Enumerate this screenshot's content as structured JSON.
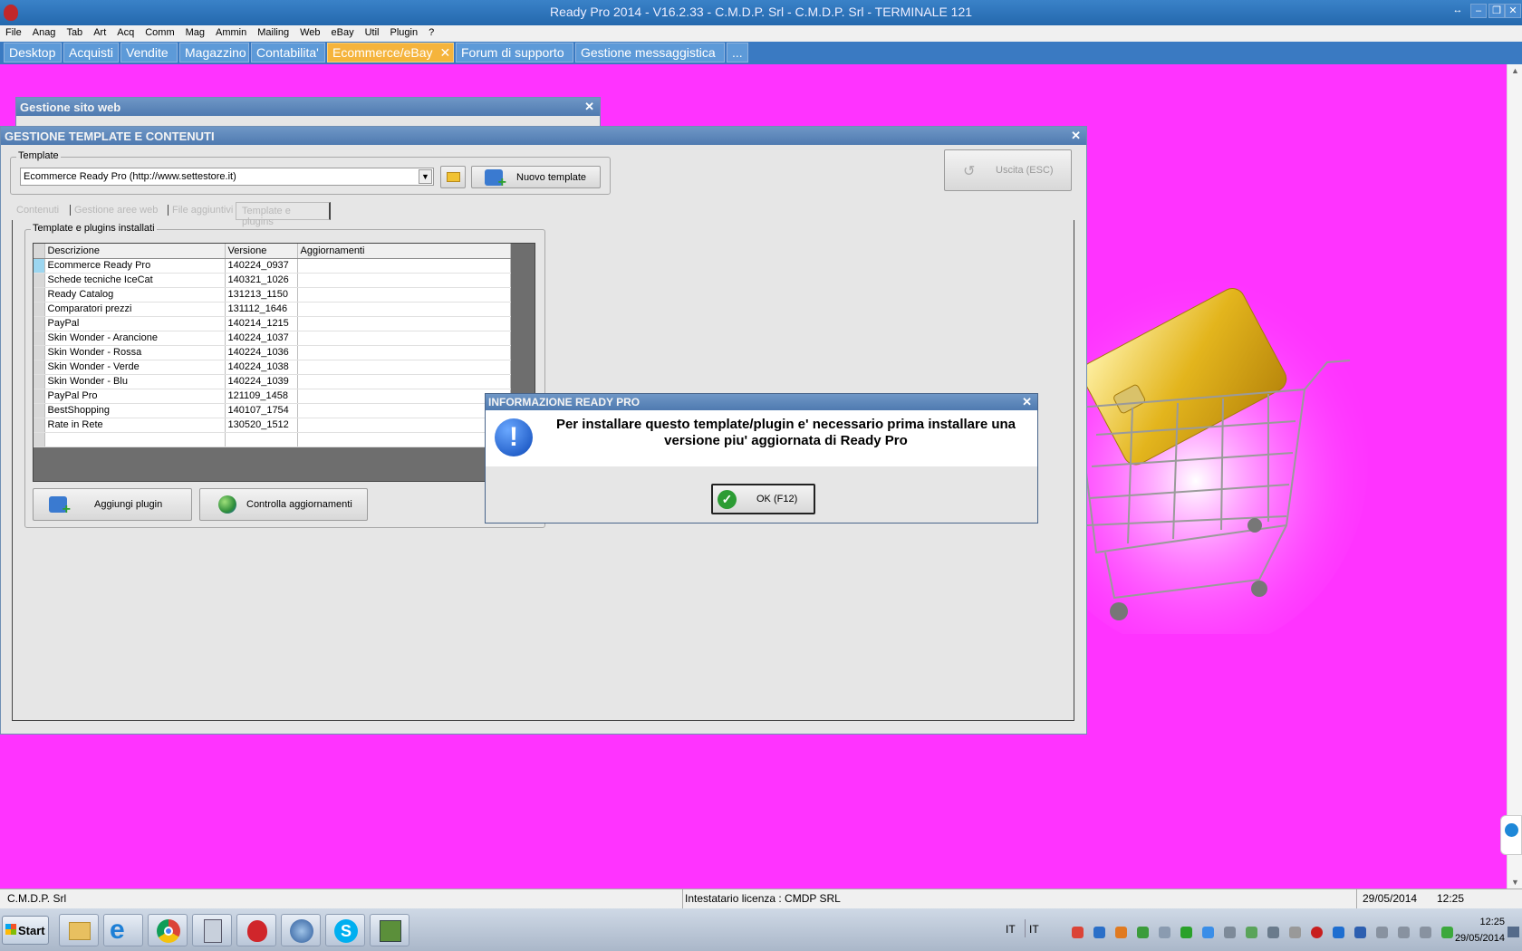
{
  "window": {
    "title": "Ready Pro 2014 - V16.2.33 - C.M.D.P. Srl - C.M.D.P. Srl - TERMINALE 121"
  },
  "menu": [
    "File",
    "Anag",
    "Tab",
    "Art",
    "Acq",
    "Comm",
    "Mag",
    "Ammin",
    "Mailing",
    "Web",
    "eBay",
    "Util",
    "Plugin",
    "?"
  ],
  "tabs": [
    "Desktop",
    "Acquisti",
    "Vendite",
    "Magazzino",
    "Contabilita'",
    "Ecommerce/eBay",
    "Forum di supporto",
    "Gestione messaggistica",
    "..."
  ],
  "active_tab": "Ecommerce/eBay",
  "bg_window": {
    "title": "Gestione sito web"
  },
  "template_window": {
    "title": "GESTIONE TEMPLATE E CONTENUTI",
    "template_label": "Template",
    "template_value": "Ecommerce Ready Pro (http://www.settestore.it)",
    "new_template": "Nuovo template",
    "exit": "Uscita (ESC)",
    "subtabs": [
      "Contenuti",
      "Gestione aree web",
      "File aggiuntivi",
      "Template e plugins"
    ],
    "group_label": "Template e plugins installati",
    "columns": [
      "Descrizione",
      "Versione",
      "Aggiornamenti"
    ],
    "rows": [
      [
        "Ecommerce Ready Pro",
        "140224_0937",
        ""
      ],
      [
        "Schede tecniche IceCat",
        "140321_1026",
        ""
      ],
      [
        "Ready Catalog",
        "131213_1150",
        ""
      ],
      [
        "Comparatori prezzi",
        "131112_1646",
        ""
      ],
      [
        "PayPal",
        "140214_1215",
        ""
      ],
      [
        "Skin Wonder - Arancione",
        "140224_1037",
        ""
      ],
      [
        "Skin Wonder - Rossa",
        "140224_1036",
        ""
      ],
      [
        "Skin Wonder - Verde",
        "140224_1038",
        ""
      ],
      [
        "Skin Wonder - Blu",
        "140224_1039",
        ""
      ],
      [
        "PayPal Pro",
        "121109_1458",
        ""
      ],
      [
        "BestShopping",
        "140107_1754",
        ""
      ],
      [
        "Rate in Rete",
        "130520_1512",
        ""
      ]
    ],
    "add_plugin": "Aggiungi plugin",
    "check_updates": "Controlla aggiornamenti"
  },
  "dialog": {
    "title": "INFORMAZIONE READY PRO",
    "message": "Per installare questo template/plugin e' necessario prima installare una versione piu' aggiornata di Ready Pro",
    "ok": "OK (F12)"
  },
  "status": {
    "company": "C.M.D.P. Srl",
    "license": "Intestatario licenza : CMDP SRL",
    "date": "29/05/2014",
    "time": "12:25"
  },
  "taskbar": {
    "start": "Start",
    "lang1": "IT",
    "lang2": "IT",
    "clock_time": "12:25",
    "clock_date": "29/05/2014"
  },
  "colors": {
    "desktop": "#ff33ff",
    "titlebar": "#2a6fb8",
    "active_tab": "#f5b43c"
  }
}
